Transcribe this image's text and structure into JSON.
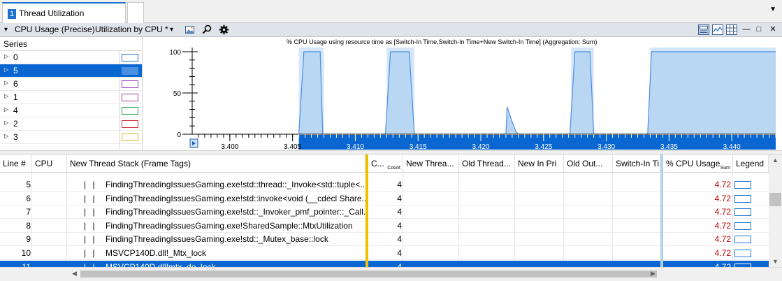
{
  "tab": {
    "number": "1",
    "title": "Thread Utilization"
  },
  "toolbar": {
    "collapse_glyph": "▾",
    "graph_name": "CPU Usage (Precise)",
    "preset": "Utilization by CPU *",
    "preset_dropdown_glyph": "▾",
    "window_controls": [
      "—",
      "□",
      "✕"
    ]
  },
  "series_panel": {
    "header": "Series",
    "items": [
      {
        "label": "0",
        "color": "#1f77d4",
        "selected": false
      },
      {
        "label": "5",
        "color": "#4a90e2",
        "selected": true
      },
      {
        "label": "6",
        "color": "#a040c0",
        "selected": false
      },
      {
        "label": "1",
        "color": "#a040a0",
        "selected": false
      },
      {
        "label": "4",
        "color": "#2ea84a",
        "selected": false
      },
      {
        "label": "2",
        "color": "#d0303a",
        "selected": false
      },
      {
        "label": "3",
        "color": "#e0b020",
        "selected": false
      }
    ]
  },
  "chart_data": {
    "type": "area",
    "title": "% CPU Usage using resource time as [Switch-In Time,Switch-In Time+New Switch-In Time] (Aggregation: Sum)",
    "xlabel": "",
    "ylabel": "",
    "xlim": [
      3.397,
      3.4435
    ],
    "ylim": [
      0,
      100
    ],
    "y_ticks": [
      "0",
      "50",
      "100"
    ],
    "x_ticks": [
      "3.400",
      "3.405",
      "3.410",
      "3.415",
      "3.420",
      "3.425",
      "3.430",
      "3.435",
      "3.440"
    ],
    "x_tick_values": [
      3.4,
      3.405,
      3.41,
      3.415,
      3.42,
      3.425,
      3.43,
      3.435,
      3.44
    ],
    "selection_range": [
      3.4055,
      3.4435
    ],
    "highlight_ranges": [
      [
        3.4055,
        3.4075
      ],
      [
        3.4125,
        3.4147
      ],
      [
        3.4272,
        3.429
      ],
      [
        3.4335,
        3.4435
      ]
    ],
    "series": [
      {
        "color": "#4a90e2",
        "x": [
          3.4055,
          3.4059,
          3.4072,
          3.4074,
          3.4124,
          3.4128,
          3.4143,
          3.4147,
          3.422,
          3.4221,
          3.4225,
          3.4228,
          3.423,
          3.4271,
          3.4275,
          3.4287,
          3.429,
          3.4333,
          3.4336,
          3.4435
        ],
        "y": [
          0,
          100,
          100,
          0,
          0,
          100,
          100,
          0,
          0,
          33,
          15,
          3,
          0,
          0,
          100,
          100,
          0,
          0,
          100,
          100
        ]
      }
    ],
    "legend": "none",
    "grid": false
  },
  "table": {
    "columns": [
      {
        "label": "Line #",
        "sub": ""
      },
      {
        "label": "CPU",
        "sub": ""
      },
      {
        "label": "New Thread Stack (Frame Tags)",
        "sub": ""
      },
      {
        "label": "C...",
        "sub": "Count"
      },
      {
        "label": "New Threa...",
        "sub": ""
      },
      {
        "label": "Old Thread...",
        "sub": ""
      },
      {
        "label": "New In Pri",
        "sub": ""
      },
      {
        "label": "Old Out...",
        "sub": ""
      },
      {
        "label": "Switch-In Ti",
        "sub": ""
      },
      {
        "label": "% CPU Usage",
        "sub": "Sum"
      },
      {
        "label": "Legend",
        "sub": ""
      }
    ],
    "rows": [
      {
        "line": "5",
        "stack": "FindingThreadingIssuesGaming.exe!std::thread::_Invoke<std::tuple<...",
        "count": "4",
        "usage": "4.72",
        "selected": false
      },
      {
        "line": "6",
        "stack": "FindingThreadingIssuesGaming.exe!std::invoke<void (__cdecl Share...",
        "count": "4",
        "usage": "4.72",
        "selected": false
      },
      {
        "line": "7",
        "stack": "FindingThreadingIssuesGaming.exe!std::_Invoker_pmf_pointer::_Call...",
        "count": "4",
        "usage": "4.72",
        "selected": false
      },
      {
        "line": "8",
        "stack": "FindingThreadingIssuesGaming.exe!SharedSample::MtxUtilization",
        "count": "4",
        "usage": "4.72",
        "selected": false
      },
      {
        "line": "9",
        "stack": "FindingThreadingIssuesGaming.exe!std::_Mutex_base::lock",
        "count": "4",
        "usage": "4.72",
        "selected": false
      },
      {
        "line": "10",
        "stack": "MSVCP140D.dll!_Mtx_lock",
        "count": "4",
        "usage": "4.72",
        "selected": false
      },
      {
        "line": "11",
        "stack": "MSVCP140D.dll!mtx_do_lock",
        "count": "4",
        "usage": "4.72",
        "selected": true
      }
    ],
    "tree_glyph": "|  |",
    "usage_color": "#c00000",
    "accent_gold": "#f0c000",
    "accent_lightblue": "#aed4ee"
  }
}
